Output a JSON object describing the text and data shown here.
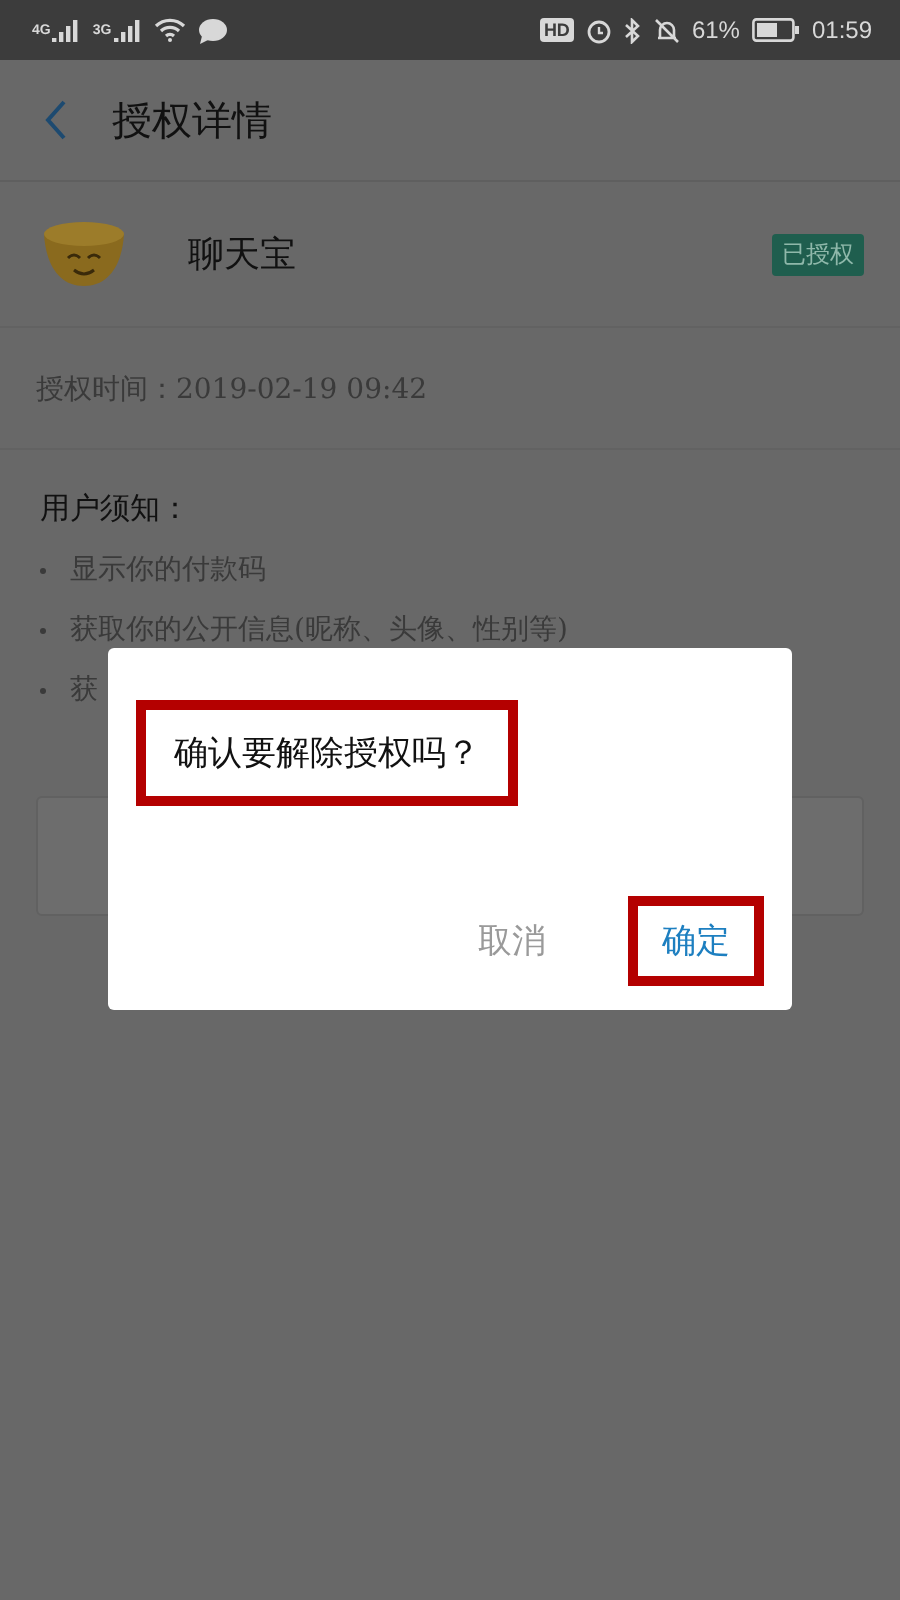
{
  "status_bar": {
    "networks": [
      "4G",
      "3G"
    ],
    "hd": "HD",
    "battery": "61%",
    "time": "01:59"
  },
  "header": {
    "title": "授权详情"
  },
  "app": {
    "name": "聊天宝",
    "badge": "已授权"
  },
  "auth_time": "授权时间：2019-02-19 09:42",
  "notice": {
    "title": "用户须知：",
    "items": [
      "显示你的付款码",
      "获取你的公开信息(昵称、头像、性别等)",
      "获"
    ]
  },
  "dialog": {
    "message": "确认要解除授权吗？",
    "message_highlighted": true,
    "buttons": [
      {
        "label": "取消",
        "kind": "cancel",
        "highlighted": false
      },
      {
        "label": "确定",
        "kind": "confirm",
        "highlighted": true
      }
    ]
  }
}
